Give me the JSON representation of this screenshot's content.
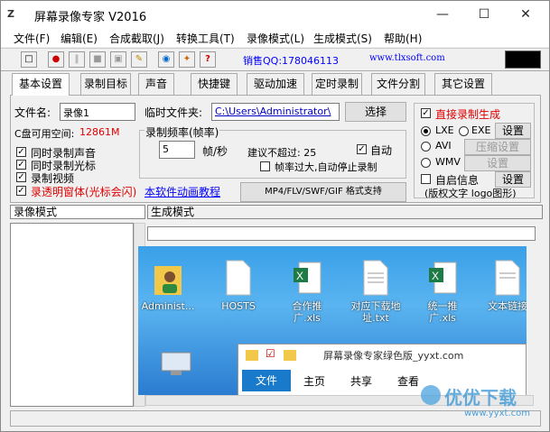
{
  "title": "屏幕录像专家 V2016",
  "window_controls": {
    "minimize": "—",
    "maximize": "☐",
    "close": "✕"
  },
  "menu": [
    "文件(F)",
    "编辑(E)",
    "合成截取(J)",
    "转换工具(T)",
    "录像模式(L)",
    "生成模式(S)",
    "帮助(H)"
  ],
  "toolbar": {
    "sales_qq": "销售QQ:178046113",
    "website": "www.tlxsoft.com"
  },
  "tabs": [
    "基本设置",
    "录制目标",
    "声音",
    "快捷键",
    "驱动加速",
    "定时录制",
    "文件分割",
    "其它设置"
  ],
  "panel": {
    "filename_label": "文件名:",
    "filename_value": "录像1",
    "tempdir_label": "临时文件夹:",
    "tempdir_value": "C:\\Users\\Administrator\\",
    "browse_button": "选择",
    "disk_space_label": "C盘可用空间:",
    "disk_space_value": "12861M",
    "record_sound": "同时录制声音",
    "record_cursor": "同时录制光标",
    "record_video": "录制视频",
    "transparent_window": "录透明窗体(光标会闪)",
    "tutorial_link": "本软件动画教程",
    "framerate_title": "录制频率(帧率)",
    "framerate_value": "5",
    "framerate_unit": "帧/秒",
    "max_suggest": "建议不超过: 25",
    "auto_label": "自动",
    "auto_stop_label": "帧率过大,自动停止录制",
    "format_button": "MP4/FLV/SWF/GIF  格式支持",
    "direct_gen_label": "直接录制生成",
    "lxe_label": "LXE",
    "exe_label": "EXE",
    "settings_button": "设置",
    "avi_label": "AVI",
    "compress_button": "压缩设置",
    "wmv_label": "WMV",
    "wmv_settings_button": "设置",
    "autoinfo_label": "自启信息",
    "autoinfo_settings_button": "设置",
    "copyright_note": "(版权文字 logo图形)"
  },
  "bottom_tabs": {
    "record_mode": "录像模式",
    "gen_mode": "生成模式"
  },
  "desktop_icons": [
    {
      "label": "Administ...",
      "icon": "user-folder-icon"
    },
    {
      "label": "HOSTS",
      "icon": "file-icon"
    },
    {
      "label": "合作推广.xls",
      "icon": "excel-icon"
    },
    {
      "label": "对应下载地址.txt",
      "icon": "text-file-icon"
    },
    {
      "label": "统一推广.xls",
      "icon": "excel-icon"
    },
    {
      "label": "文本链接",
      "icon": "text-file-icon"
    }
  ],
  "explorer": {
    "title": "屏幕录像专家绿色版_yyxt.com",
    "ribbon_tabs": [
      "文件",
      "主页",
      "共享",
      "查看"
    ]
  },
  "watermark": {
    "text": "优优下载",
    "url": "www.yyxt.com"
  },
  "colors": {
    "red_text": "#e00000",
    "link_blue": "#0000ff",
    "explorer_accent": "#1979ca"
  }
}
